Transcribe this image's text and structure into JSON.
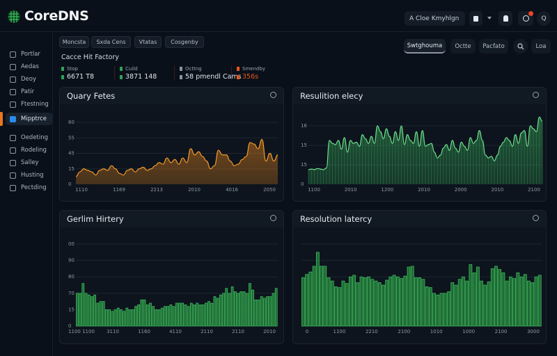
{
  "header": {
    "brand": "CoreDNS",
    "search_text": "A  Cloe Kmyhlgn",
    "lock_icon": "lock-icon",
    "user_icon": "user-icon",
    "notification_icon": "bell-icon",
    "account_label": "Q"
  },
  "sidebar": {
    "items": [
      {
        "label": "Portlar",
        "icon": "calendar-icon"
      },
      {
        "label": "Aedas",
        "icon": "inbox-icon"
      },
      {
        "label": "Deoy",
        "icon": "file-icon"
      },
      {
        "label": "Patir",
        "icon": "pen-icon"
      },
      {
        "label": "Ftestning",
        "icon": "box-icon"
      },
      {
        "label": "Mipptrce",
        "icon": "folder-icon",
        "active": true
      },
      {
        "label": "Oedeting",
        "icon": "link-icon"
      },
      {
        "label": "Rodeling",
        "icon": "chart-icon"
      },
      {
        "label": "Salley",
        "icon": "globe-icon"
      },
      {
        "label": "Husting",
        "icon": "refresh-icon"
      },
      {
        "label": "Pectding",
        "icon": "layers-icon"
      }
    ]
  },
  "tabs": [
    "Moncsta",
    "Sxda Cens",
    "Vtatas",
    "Cosgenby"
  ],
  "right_tabs": [
    {
      "label": "Swtghouma",
      "active": true
    },
    {
      "label": "Octte"
    },
    {
      "label": "Pacfato"
    },
    {
      "label": "Loa"
    }
  ],
  "stats": {
    "title": "Cacce Hit Factory",
    "items": [
      {
        "label": "Stop",
        "value": "6671 T8",
        "color": "#2ea05a"
      },
      {
        "label": "Cuild",
        "value": "3871 148",
        "color": "#2ea05a"
      },
      {
        "label": "Octtng",
        "value": "58 pmendl Cams",
        "color": "#8a939e"
      },
      {
        "label": "Smendby",
        "value": "356s",
        "color": "#e8561e"
      }
    ]
  },
  "colors": {
    "accent": "#e8761e",
    "orange": "#f08a1c",
    "green": "#3fbf62",
    "notification": "#e8462a"
  },
  "chart_data": [
    {
      "type": "area",
      "title": "Quary Fetes",
      "color": "#f08a1c",
      "ylim": [
        0,
        60
      ],
      "y_ticks": [
        "0",
        "15",
        "45",
        "55",
        "60"
      ],
      "x_ticks": [
        "1110",
        "1169",
        "2213",
        "2010",
        "4016",
        "2050"
      ],
      "values": [
        7.5,
        12,
        15,
        13.5,
        12,
        9,
        13.5,
        15,
        13.5,
        18,
        15,
        10.5,
        9,
        13.5,
        15,
        12,
        15,
        16.5,
        13.5,
        15,
        18,
        21,
        19.5,
        25.5,
        21,
        24,
        19.5,
        25.5,
        21,
        34.5,
        28.5,
        31.5,
        27,
        22.5,
        15,
        18,
        33,
        28.5,
        28.5,
        22.5,
        18,
        19.5,
        24,
        27,
        40.5,
        39,
        34.5,
        43.5,
        22.5,
        30,
        22.5,
        28.5
      ]
    },
    {
      "type": "area",
      "title": "Resulition elecy",
      "color": "#3fbf62",
      "ylim": [
        0,
        100
      ],
      "y_ticks": [
        "0",
        "15",
        "15",
        "16"
      ],
      "x_ticks": [
        "1100",
        "2010",
        "1200",
        "2010",
        "2000",
        "2010",
        "2100"
      ],
      "values": [
        25,
        26,
        25,
        27,
        26,
        25,
        28,
        75,
        70,
        68,
        75,
        60,
        80,
        55,
        75,
        70,
        72,
        65,
        85,
        78,
        70,
        82,
        70,
        100,
        90,
        78,
        95,
        82,
        70,
        90,
        75,
        100,
        68,
        85,
        75,
        70,
        90,
        65,
        92,
        65,
        68,
        70,
        55,
        45,
        50,
        62,
        68,
        58,
        75,
        62,
        55,
        72,
        65,
        58,
        80,
        70,
        75,
        92,
        75,
        50,
        45,
        48,
        40,
        50,
        65,
        72,
        80,
        75,
        65,
        85,
        70,
        88,
        92,
        65,
        100,
        95,
        90,
        115,
        108
      ]
    },
    {
      "type": "bar",
      "title": "Gerlim Hirtery",
      "color": "#3fbf62",
      "ylim": [
        0,
        5
      ],
      "y_ticks": [
        "0",
        "15",
        "70",
        "80",
        "90",
        "00"
      ],
      "x_ticks": [
        "1100 1100",
        "3110",
        "1160",
        "4110",
        "2110",
        "2110",
        "2010"
      ],
      "values": [
        2.0,
        2.0,
        2.6,
        2.0,
        1.9,
        1.8,
        1.9,
        1.4,
        1.5,
        1.5,
        1.0,
        1.0,
        0.9,
        1.0,
        1.1,
        1.0,
        0.9,
        1.1,
        1.0,
        1.0,
        1.2,
        1.3,
        1.6,
        1.6,
        1.3,
        1.4,
        1.2,
        1.0,
        1.0,
        1.1,
        1.2,
        1.2,
        1.3,
        1.2,
        1.4,
        1.4,
        1.4,
        1.3,
        1.2,
        1.4,
        1.3,
        1.4,
        1.3,
        1.3,
        1.4,
        1.5,
        1.4,
        1.8,
        1.7,
        1.9,
        2.0,
        2.3,
        2.0,
        2.4,
        2.1,
        2.0,
        2.1,
        2.1,
        2.0,
        2.6,
        2.2,
        1.6,
        1.6,
        1.8,
        1.7,
        1.8,
        1.8,
        2.0,
        2.3
      ]
    },
    {
      "type": "bar",
      "title": "Resolution latercy",
      "color": "#3fbf62",
      "ylim": [
        0,
        100
      ],
      "y_ticks": [],
      "x_ticks": [
        "0",
        "1100",
        "2210",
        "2100",
        "1010",
        "1000",
        "2100",
        "3000"
      ],
      "values": [
        59,
        63,
        66,
        73,
        90,
        73,
        73,
        59,
        55,
        48,
        47,
        55,
        52,
        60,
        62,
        53,
        60,
        59,
        60,
        57,
        55,
        53,
        50,
        56,
        60,
        62,
        60,
        58,
        61,
        72,
        73,
        59,
        59,
        57,
        48,
        47,
        40,
        38,
        40,
        40,
        42,
        53,
        50,
        57,
        60,
        55,
        75,
        65,
        72,
        55,
        50,
        54,
        70,
        73,
        69,
        65,
        55,
        60,
        58,
        65,
        60,
        63,
        55,
        53,
        60,
        62
      ]
    }
  ]
}
